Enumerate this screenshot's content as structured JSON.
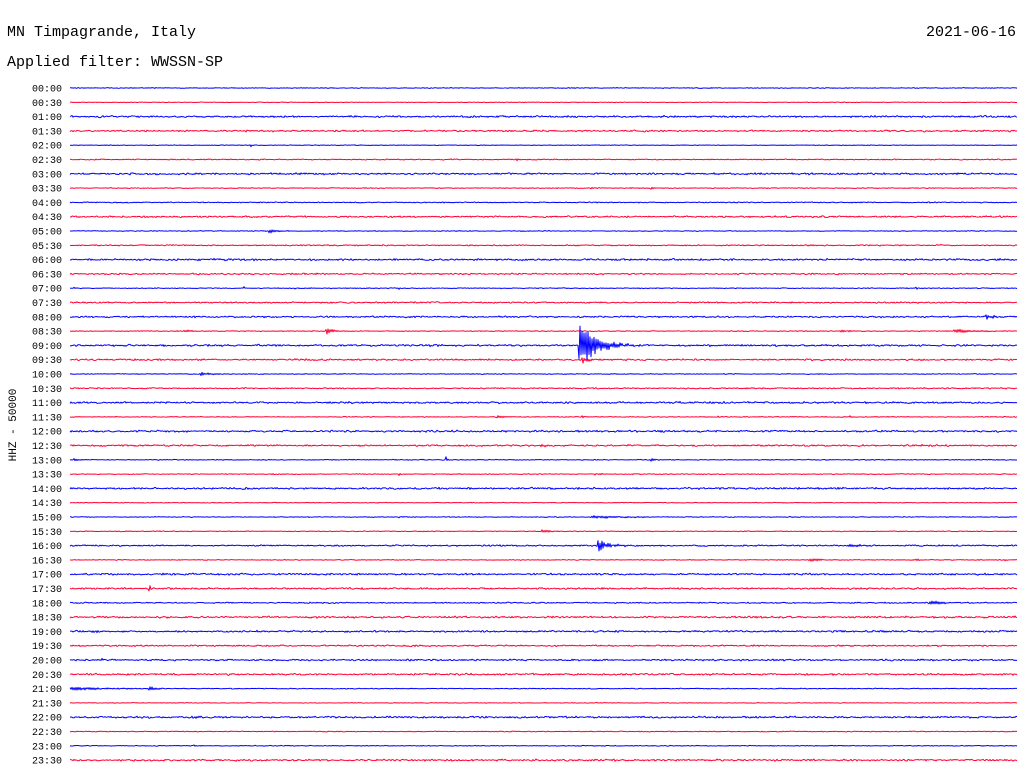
{
  "chart_data": {
    "type": "line",
    "title": "MN Timpagrande, Italy",
    "date": "2021-06-16",
    "subtitle": "Applied filter: WWSSN-SP",
    "ylabel": "HHZ - 50000",
    "xlim": [
      0,
      30
    ],
    "series_colors": [
      "#0000ff",
      "#ff0033"
    ],
    "rows": [
      {
        "label": "00:00",
        "noise": 0.04
      },
      {
        "label": "00:30",
        "noise": 0.03
      },
      {
        "label": "01:00",
        "noise": 0.09
      },
      {
        "label": "01:30",
        "noise": 0.08
      },
      {
        "label": "02:00",
        "noise": 0.03
      },
      {
        "label": "02:30",
        "noise": 0.05
      },
      {
        "label": "03:00",
        "noise": 0.09
      },
      {
        "label": "03:30",
        "noise": 0.04
      },
      {
        "label": "04:00",
        "noise": 0.05
      },
      {
        "label": "04:30",
        "noise": 0.08
      },
      {
        "label": "05:00",
        "noise": 0.04
      },
      {
        "label": "05:30",
        "noise": 0.06
      },
      {
        "label": "06:00",
        "noise": 0.09
      },
      {
        "label": "06:30",
        "noise": 0.07
      },
      {
        "label": "07:00",
        "noise": 0.04
      },
      {
        "label": "07:30",
        "noise": 0.07
      },
      {
        "label": "08:00",
        "noise": 0.08
      },
      {
        "label": "08:30",
        "noise": 0.04
      },
      {
        "label": "09:00",
        "noise": 0.09
      },
      {
        "label": "09:30",
        "noise": 0.08
      },
      {
        "label": "10:00",
        "noise": 0.04
      },
      {
        "label": "10:30",
        "noise": 0.06
      },
      {
        "label": "11:00",
        "noise": 0.09
      },
      {
        "label": "11:30",
        "noise": 0.04
      },
      {
        "label": "12:00",
        "noise": 0.09
      },
      {
        "label": "12:30",
        "noise": 0.08
      },
      {
        "label": "13:00",
        "noise": 0.04
      },
      {
        "label": "13:30",
        "noise": 0.04
      },
      {
        "label": "14:00",
        "noise": 0.09
      },
      {
        "label": "14:30",
        "noise": 0.03
      },
      {
        "label": "15:00",
        "noise": 0.04
      },
      {
        "label": "15:30",
        "noise": 0.04
      },
      {
        "label": "16:00",
        "noise": 0.07
      },
      {
        "label": "16:30",
        "noise": 0.04
      },
      {
        "label": "17:00",
        "noise": 0.09
      },
      {
        "label": "17:30",
        "noise": 0.08
      },
      {
        "label": "18:00",
        "noise": 0.06
      },
      {
        "label": "18:30",
        "noise": 0.09
      },
      {
        "label": "19:00",
        "noise": 0.09
      },
      {
        "label": "19:30",
        "noise": 0.07
      },
      {
        "label": "20:00",
        "noise": 0.08
      },
      {
        "label": "20:30",
        "noise": 0.09
      },
      {
        "label": "21:00",
        "noise": 0.04
      },
      {
        "label": "21:30",
        "noise": 0.03
      },
      {
        "label": "22:00",
        "noise": 0.09
      },
      {
        "label": "22:30",
        "noise": 0.04
      },
      {
        "label": "23:00",
        "noise": 0.04
      },
      {
        "label": "23:30",
        "noise": 0.09
      }
    ],
    "events": [
      {
        "row": "02:00",
        "minute": 5.7,
        "duration": 0.2,
        "amplitude": 0.15
      },
      {
        "row": "02:30",
        "minute": 14.1,
        "duration": 0.5,
        "amplitude": 0.1
      },
      {
        "row": "03:30",
        "minute": 16.5,
        "duration": 0.2,
        "amplitude": 0.12
      },
      {
        "row": "03:30",
        "minute": 18.4,
        "duration": 0.2,
        "amplitude": 0.12
      },
      {
        "row": "05:00",
        "minute": 6.3,
        "duration": 0.7,
        "amplitude": 0.18
      },
      {
        "row": "07:00",
        "minute": 0.1,
        "duration": 0.1,
        "amplitude": 0.12
      },
      {
        "row": "07:00",
        "minute": 5.5,
        "duration": 0.1,
        "amplitude": 0.12
      },
      {
        "row": "07:00",
        "minute": 7.1,
        "duration": 0.1,
        "amplitude": 0.1
      },
      {
        "row": "07:00",
        "minute": 10.4,
        "duration": 0.1,
        "amplitude": 0.12
      },
      {
        "row": "07:00",
        "minute": 26.8,
        "duration": 0.1,
        "amplitude": 0.12
      },
      {
        "row": "08:00",
        "minute": 29.0,
        "duration": 0.6,
        "amplitude": 0.2
      },
      {
        "row": "08:30",
        "minute": 3.6,
        "duration": 0.6,
        "amplitude": 0.12
      },
      {
        "row": "08:30",
        "minute": 8.1,
        "duration": 0.6,
        "amplitude": 0.22
      },
      {
        "row": "08:30",
        "minute": 24.4,
        "duration": 0.6,
        "amplitude": 0.12
      },
      {
        "row": "08:30",
        "minute": 28.0,
        "duration": 1.9,
        "amplitude": 0.15
      },
      {
        "row": "09:00",
        "minute": 16.1,
        "duration": 1.6,
        "amplitude": 1.6
      },
      {
        "row": "09:30",
        "minute": 16.2,
        "duration": 0.7,
        "amplitude": 0.25
      },
      {
        "row": "10:00",
        "minute": 4.1,
        "duration": 0.8,
        "amplitude": 0.15
      },
      {
        "row": "11:30",
        "minute": 13.5,
        "duration": 0.7,
        "amplitude": 0.1
      },
      {
        "row": "11:30",
        "minute": 14.7,
        "duration": 0.2,
        "amplitude": 0.1
      },
      {
        "row": "11:30",
        "minute": 16.2,
        "duration": 0.2,
        "amplitude": 0.12
      },
      {
        "row": "11:30",
        "minute": 20.5,
        "duration": 0.2,
        "amplitude": 0.1
      },
      {
        "row": "11:30",
        "minute": 24.7,
        "duration": 0.2,
        "amplitude": 0.1
      },
      {
        "row": "12:30",
        "minute": 14.9,
        "duration": 0.3,
        "amplitude": 0.12
      },
      {
        "row": "13:00",
        "minute": 0.1,
        "duration": 0.6,
        "amplitude": 0.12
      },
      {
        "row": "13:00",
        "minute": 11.9,
        "duration": 0.1,
        "amplitude": 0.4
      },
      {
        "row": "13:00",
        "minute": 18.4,
        "duration": 0.5,
        "amplitude": 0.1
      },
      {
        "row": "13:30",
        "minute": 10.4,
        "duration": 0.3,
        "amplitude": 0.1
      },
      {
        "row": "13:30",
        "minute": 16.6,
        "duration": 0.6,
        "amplitude": 0.08
      },
      {
        "row": "15:00",
        "minute": 10.4,
        "duration": 0.2,
        "amplitude": 0.1
      },
      {
        "row": "15:00",
        "minute": 16.5,
        "duration": 3.5,
        "amplitude": 0.08
      },
      {
        "row": "15:00",
        "minute": 22.8,
        "duration": 0.2,
        "amplitude": 0.1
      },
      {
        "row": "15:30",
        "minute": 14.9,
        "duration": 0.9,
        "amplitude": 0.12
      },
      {
        "row": "16:00",
        "minute": 16.7,
        "duration": 1.0,
        "amplitude": 0.45
      },
      {
        "row": "16:00",
        "minute": 24.7,
        "duration": 0.6,
        "amplitude": 0.15
      },
      {
        "row": "16:30",
        "minute": 18.1,
        "duration": 0.1,
        "amplitude": 0.15
      },
      {
        "row": "16:30",
        "minute": 23.4,
        "duration": 1.2,
        "amplitude": 0.1
      },
      {
        "row": "16:30",
        "minute": 26.8,
        "duration": 0.3,
        "amplitude": 0.12
      },
      {
        "row": "16:30",
        "minute": 29.6,
        "duration": 0.1,
        "amplitude": 0.15
      },
      {
        "row": "17:30",
        "minute": 2.5,
        "duration": 0.1,
        "amplitude": 0.5
      },
      {
        "row": "17:30",
        "minute": 9.2,
        "duration": 0.1,
        "amplitude": 0.25
      },
      {
        "row": "18:00",
        "minute": 27.2,
        "duration": 1.1,
        "amplitude": 0.18
      },
      {
        "row": "20:00",
        "minute": 1.0,
        "duration": 0.2,
        "amplitude": 0.15
      },
      {
        "row": "21:00",
        "minute": 0.0,
        "duration": 3.0,
        "amplitude": 0.12
      },
      {
        "row": "21:00",
        "minute": 2.5,
        "duration": 0.5,
        "amplitude": 0.18
      },
      {
        "row": "23:00",
        "minute": 3.9,
        "duration": 0.1,
        "amplitude": 0.15
      }
    ]
  }
}
